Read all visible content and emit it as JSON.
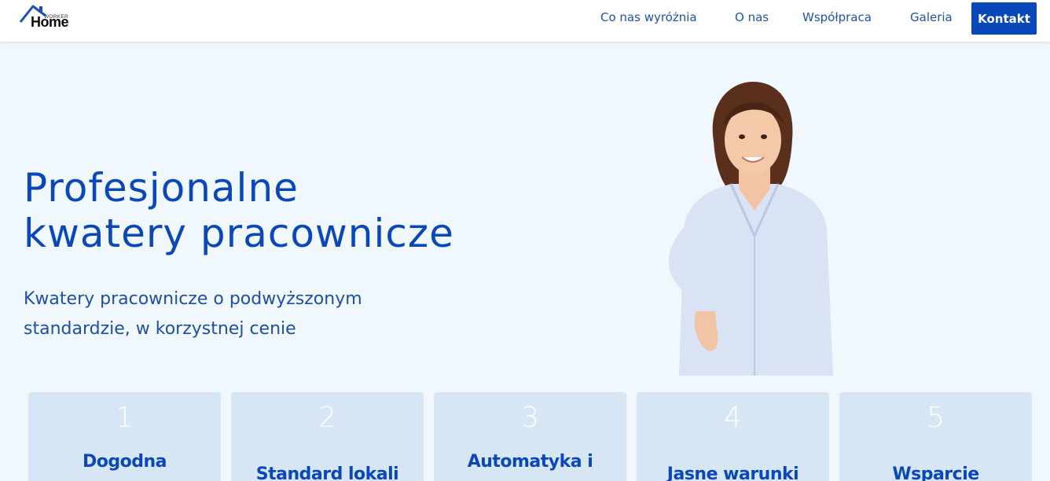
{
  "header": {
    "logo_top": "WORKER",
    "logo_main": "Home"
  },
  "nav": {
    "items": [
      {
        "label": "Co nas wyróżnia"
      },
      {
        "label": "O nas"
      },
      {
        "label": "Współpraca"
      },
      {
        "label": "Galeria"
      }
    ],
    "cta_label": "Kontakt"
  },
  "hero": {
    "title_line1": "Profesjonalne",
    "title_line2": "kwatery pracownicze",
    "subtitle_line1": "Kwatery pracownicze o podwyższonym",
    "subtitle_line2": "standardzie, w korzystnej cenie"
  },
  "features": [
    {
      "number": "1",
      "title": "Dogodna"
    },
    {
      "number": "2",
      "title": "Standard lokali"
    },
    {
      "number": "3",
      "title": "Automatyka i"
    },
    {
      "number": "4",
      "title": "Jasne warunki"
    },
    {
      "number": "5",
      "title": "Wsparcie"
    }
  ],
  "colors": {
    "brand": "#0a47b8",
    "background": "#f0f8fe",
    "card": "#d6e6f5"
  }
}
